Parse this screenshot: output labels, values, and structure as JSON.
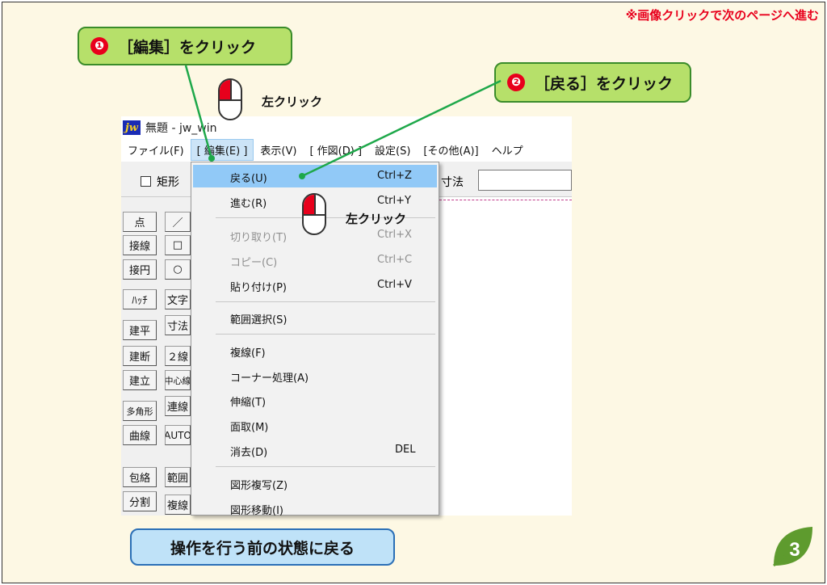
{
  "notice": "※画像クリックで次のページへ進む",
  "callouts": {
    "step1_num": "❶",
    "step1_text": "［編集］をクリック",
    "step2_num": "❷",
    "step2_text": "［戻る］をクリック"
  },
  "click_label": "左クリック",
  "window": {
    "title": "無題 - jw_win",
    "logo": "jw",
    "menu": [
      "ファイル(F)",
      "[ 編集(E) ]",
      "表示(V)",
      "[ 作図(D) ]",
      "設定(S)",
      "[その他(A)]",
      "ヘルプ"
    ],
    "toolbar": {
      "checkbox_label": "矩形",
      "dim_label": "寸法"
    },
    "left_tools_col1": [
      "点",
      "接線",
      "接円",
      "ﾊｯﾁ",
      "建平",
      "建断",
      "建立",
      "多角形",
      "曲線",
      "包絡",
      "分割"
    ],
    "left_tools_col2": [
      "／",
      "□",
      "○",
      "文字",
      "寸法",
      "２線",
      "中心線",
      "連線",
      "AUTO",
      "範囲",
      "複線"
    ]
  },
  "edit_menu": [
    {
      "label": "戻る(U)",
      "shortcut": "Ctrl+Z",
      "state": "highlighted"
    },
    {
      "label": "進む(R)",
      "shortcut": "Ctrl+Y",
      "state": "normal"
    },
    {
      "label": "切り取り(T)",
      "shortcut": "Ctrl+X",
      "state": "disabled"
    },
    {
      "label": "コピー(C)",
      "shortcut": "Ctrl+C",
      "state": "disabled"
    },
    {
      "label": "貼り付け(P)",
      "shortcut": "Ctrl+V",
      "state": "normal"
    },
    {
      "label": "範囲選択(S)",
      "shortcut": "",
      "state": "normal"
    },
    {
      "label": "複線(F)",
      "shortcut": "",
      "state": "normal"
    },
    {
      "label": "コーナー処理(A)",
      "shortcut": "",
      "state": "normal"
    },
    {
      "label": "伸縮(T)",
      "shortcut": "",
      "state": "normal"
    },
    {
      "label": "面取(M)",
      "shortcut": "",
      "state": "normal"
    },
    {
      "label": "消去(D)",
      "shortcut": "DEL",
      "state": "normal"
    },
    {
      "label": "図形複写(Z)",
      "shortcut": "",
      "state": "normal"
    },
    {
      "label": "図形移動(I)",
      "shortcut": "",
      "state": "normal"
    }
  ],
  "bottom_caption": "操作を行う前の状態に戻る",
  "page_number": "3",
  "colors": {
    "callout_green": "#b6e06a",
    "accent_red": "#e8001c",
    "caption_blue": "#bfe2f8",
    "leaf_green": "#5e9b2e"
  }
}
